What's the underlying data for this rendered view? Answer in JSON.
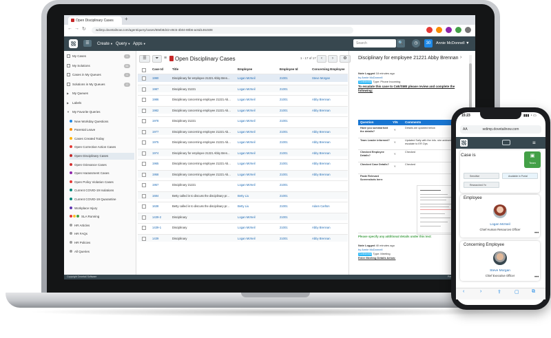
{
  "browser": {
    "tab_title": "Open Disciplinary Cases",
    "new_tab": "+",
    "url": "wdimp.dovetailnow.com/agent/query/cases/68eb8d42-e9c5-4b04-80b6-ac6d146c508",
    "back": "←",
    "forward": "→",
    "reload": "↻"
  },
  "app": {
    "home": "☰",
    "menu": [
      "Create",
      "Query",
      "Apps"
    ],
    "search_placeholder": "Search",
    "search_icon": "🔍",
    "user_initials": "30",
    "user_name": "Annie McDonnell",
    "footer": "Copyright Dovetail Software",
    "footer_right": "Press ? for shortcuts"
  },
  "sidebar": {
    "items": [
      {
        "label": "My Cases",
        "count": "1"
      },
      {
        "label": "My Solutions",
        "count": "61"
      },
      {
        "label": "Cases in My Queues",
        "count": "1"
      },
      {
        "label": "Solutions in My Queues",
        "count": "0"
      },
      {
        "label": "My Queues",
        "count": ""
      },
      {
        "label": "Labels",
        "count": ""
      },
      {
        "label": "My Favorite Queries",
        "count": ""
      }
    ],
    "favorites": [
      "New Workday Questions",
      "Parental Leave",
      "Cases Created Today",
      "Open Corrective Action Cases",
      "Open Disciplinary Cases",
      "Open Grievance Cases",
      "Open Harassment Cases",
      "Open Policy Violation Cases",
      "Current COVID-19 Isolations",
      "Current COVID-19 Quarantine",
      "Workplace Injury",
      "SLA Running",
      "HR Articles",
      "HR FAQs",
      "HR Policies",
      "All Queries"
    ]
  },
  "list": {
    "title": "Open Disciplinary Cases",
    "count_label": "1 - 17 of 17",
    "columns": [
      "Case Id",
      "Title",
      "Employee",
      "Employee Id",
      "Concerning Employee"
    ],
    "rows": [
      [
        "1990",
        "Disciplinary for employee 21221 Abby Bren...",
        "Logan McNeil",
        "21001",
        "Steve Morgan"
      ],
      [
        "1987",
        "Disciplinary 21221",
        "Logan McNeil",
        "21001",
        ""
      ],
      [
        "1986",
        "Disciplinary concerning employee 21221 Ab...",
        "Logan McNeil",
        "21001",
        "Abby Brennan"
      ],
      [
        "1982",
        "Disciplinary concerning employee 21221 Ab...",
        "Logan McNeil",
        "21001",
        "Abby Brennan"
      ],
      [
        "1978",
        "Disciplinary 21221",
        "Logan McNeil",
        "21001",
        ""
      ],
      [
        "1977",
        "Disciplinary concerning employee 21221 Ab...",
        "Logan McNeil",
        "21001",
        "Abby Brennan"
      ],
      [
        "1975",
        "Disciplinary concerning employee 21221 Ab...",
        "Logan McNeil",
        "21001",
        "Abby Brennan"
      ],
      [
        "1974",
        "Disciplinary for employee 21221 Abby Bren...",
        "Logan McNeil",
        "21001",
        "Abby Brennan"
      ],
      [
        "1965",
        "Disciplinary concerning employee 21221 Ab...",
        "Logan McNeil",
        "21001",
        "Abby Brennan"
      ],
      [
        "1958",
        "Disciplinary concerning employee 21221 Ab...",
        "Logan McNeil",
        "21001",
        "Abby Brennan"
      ],
      [
        "1957",
        "Disciplinary 21221",
        "Logan McNeil",
        "21001",
        ""
      ],
      [
        "1684",
        "Betty called in to discuss the disciplinary pr...",
        "Betty Liu",
        "21001",
        ""
      ],
      [
        "1638",
        "Betty called in to discuss the disciplinary pr...",
        "Betty Liu",
        "21001",
        "Adam Carlton"
      ],
      [
        "1439-2",
        "Disciplinary",
        "Logan McNeil",
        "21001",
        ""
      ],
      [
        "1439-1",
        "Disciplinary",
        "Logan McNeil",
        "21001",
        "Abby Brennan"
      ],
      [
        "1439",
        "Disciplinary",
        "Logan McNeil",
        "21001",
        "Abby Brennan"
      ]
    ]
  },
  "detail": {
    "title": "Disciplinary for employee 21221 Abby Brennan",
    "note1_header": "Note Logged",
    "note1_time": "18 minutes ago",
    "note1_by": "by Annie McDonnell",
    "note1_badge": "Confidential",
    "note1_type": "Type: Phone Incoming",
    "escalate": "To escalate this case to CoE/SME please review and complete the following:",
    "q_columns": [
      "Question",
      "Y/N",
      "Comments"
    ],
    "questions": [
      {
        "q": "Have you summarised the details?",
        "yn": "Y",
        "c": "Details are updated below"
      },
      {
        "q": "Team Leader informed?",
        "yn": "Y",
        "c": "Updated Sally with the info. she advised to escalate to ER Ops"
      },
      {
        "q": "Checked Employee Details?",
        "yn": "Y",
        "c": "Checked"
      },
      {
        "q": "Checked Case Details?",
        "yn": "Y",
        "c": "Checked"
      },
      {
        "q": "Paste Relevant Screenshots here:",
        "yn": "",
        "c": ""
      }
    ],
    "specify": "Please specify any additional details under this text:",
    "note2_header": "Note Logged",
    "note2_time": "40 minutes ago",
    "note2_by": "by Annie McDonnell",
    "note2_badge": "Confidential",
    "note2_type": "Type: Meeting",
    "note2_enter": "Enter Meeting Details below:"
  },
  "phone": {
    "time": "15:23",
    "signal": "▮▮▮ ◔ ▭",
    "url": "wdimp.dovetailnow.com",
    "aa": "AA",
    "case_label": "Case is",
    "team_label": "Team",
    "chips": [
      "Sensitive",
      "Available in Portal",
      "Researched Yn"
    ],
    "employee_label": "Employee",
    "employee_name": "Logan McNeil",
    "employee_role": "Chief Human Resources Officer",
    "concerning_label": "Concerning Employee",
    "concerning_name": "Steve Morgan",
    "concerning_role": "Chief Executive Officer",
    "dots": "•••",
    "bottom_icons": [
      "‹",
      "›",
      "⇪",
      "▢",
      "⧉"
    ]
  },
  "colors": {
    "header": "#37474f",
    "accent": "#1976d2",
    "green": "#43a047"
  }
}
